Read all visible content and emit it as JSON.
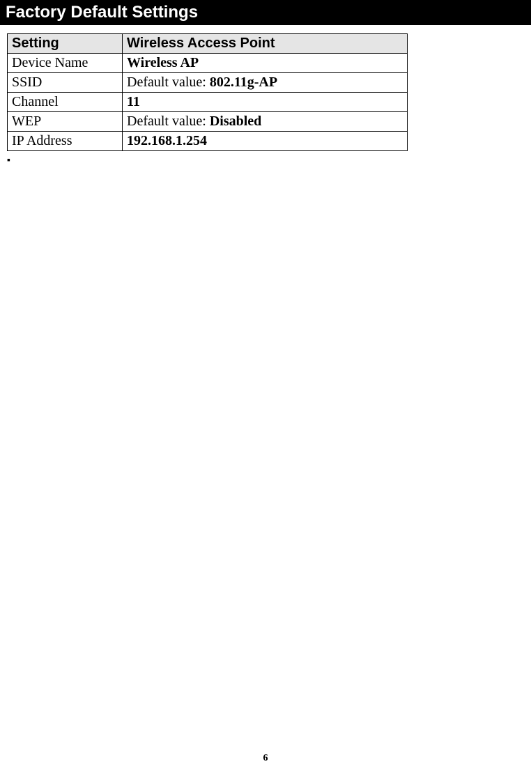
{
  "title": "Factory Default Settings",
  "table": {
    "header": {
      "col1": "Setting",
      "col2": "Wireless Access Point"
    },
    "rows": [
      {
        "setting": "Device Name",
        "value_prefix": "",
        "value_bold": "Wireless AP",
        "value_suffix": ""
      },
      {
        "setting": "SSID",
        "value_prefix": "Default value: ",
        "value_bold": "802.11g-AP",
        "value_suffix": ""
      },
      {
        "setting": "Channel",
        "value_prefix": "",
        "value_bold": "11",
        "value_suffix": ""
      },
      {
        "setting": "WEP",
        "value_prefix": "Default value: ",
        "value_bold": "Disabled",
        "value_suffix": ""
      },
      {
        "setting": "IP Address",
        "value_prefix": "",
        "value_bold": "192.168.1.254",
        "value_suffix": ""
      }
    ]
  },
  "bullet": "▪",
  "page_number": "6"
}
